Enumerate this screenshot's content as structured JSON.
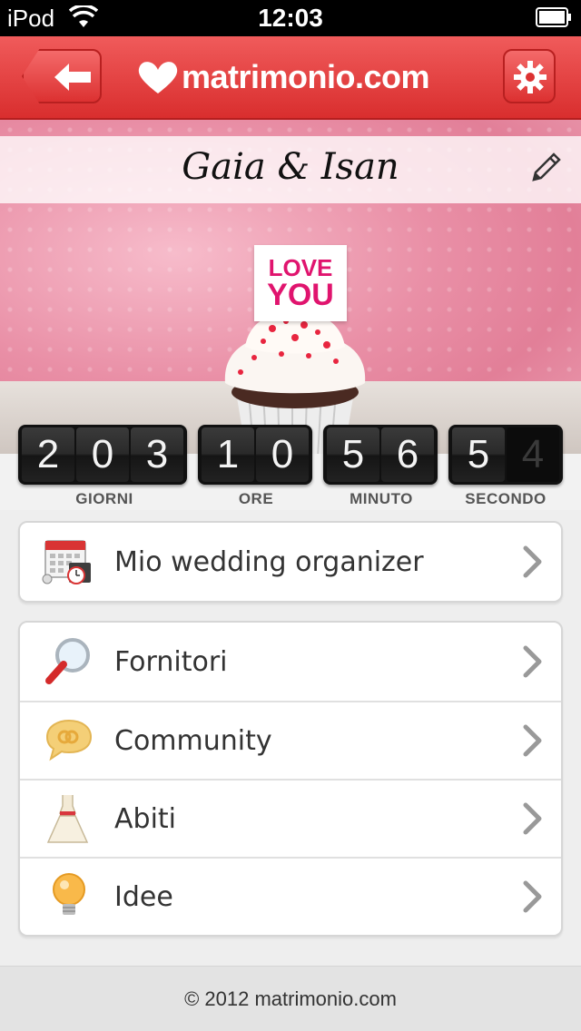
{
  "status_bar": {
    "carrier": "iPod",
    "time": "12:03"
  },
  "navbar": {
    "brand": "matrimonio.com"
  },
  "hero": {
    "couple_name": "Gaia & Isan",
    "sign_line1": "LOVE",
    "sign_line2": "YOU"
  },
  "countdown": {
    "groups": [
      {
        "label": "GIORNI",
        "digits": [
          "2",
          "0",
          "3"
        ]
      },
      {
        "label": "ORE",
        "digits": [
          "1",
          "0"
        ]
      },
      {
        "label": "MINUTO",
        "digits": [
          "5",
          "6"
        ]
      },
      {
        "label": "SECONDO",
        "digits": [
          "5",
          "4"
        ]
      }
    ]
  },
  "organizer": {
    "label": "Mio wedding organizer",
    "icon": "calendar-icon"
  },
  "menu": {
    "items": [
      {
        "label": "Fornitori",
        "icon": "magnifier-icon"
      },
      {
        "label": "Community",
        "icon": "chat-rings-icon"
      },
      {
        "label": "Abiti",
        "icon": "dress-icon"
      },
      {
        "label": "Idee",
        "icon": "lightbulb-icon"
      }
    ]
  },
  "footer": {
    "copyright": "© 2012 matrimonio.com"
  },
  "colors": {
    "accent": "#e03a3a",
    "background": "#eeeeee"
  }
}
